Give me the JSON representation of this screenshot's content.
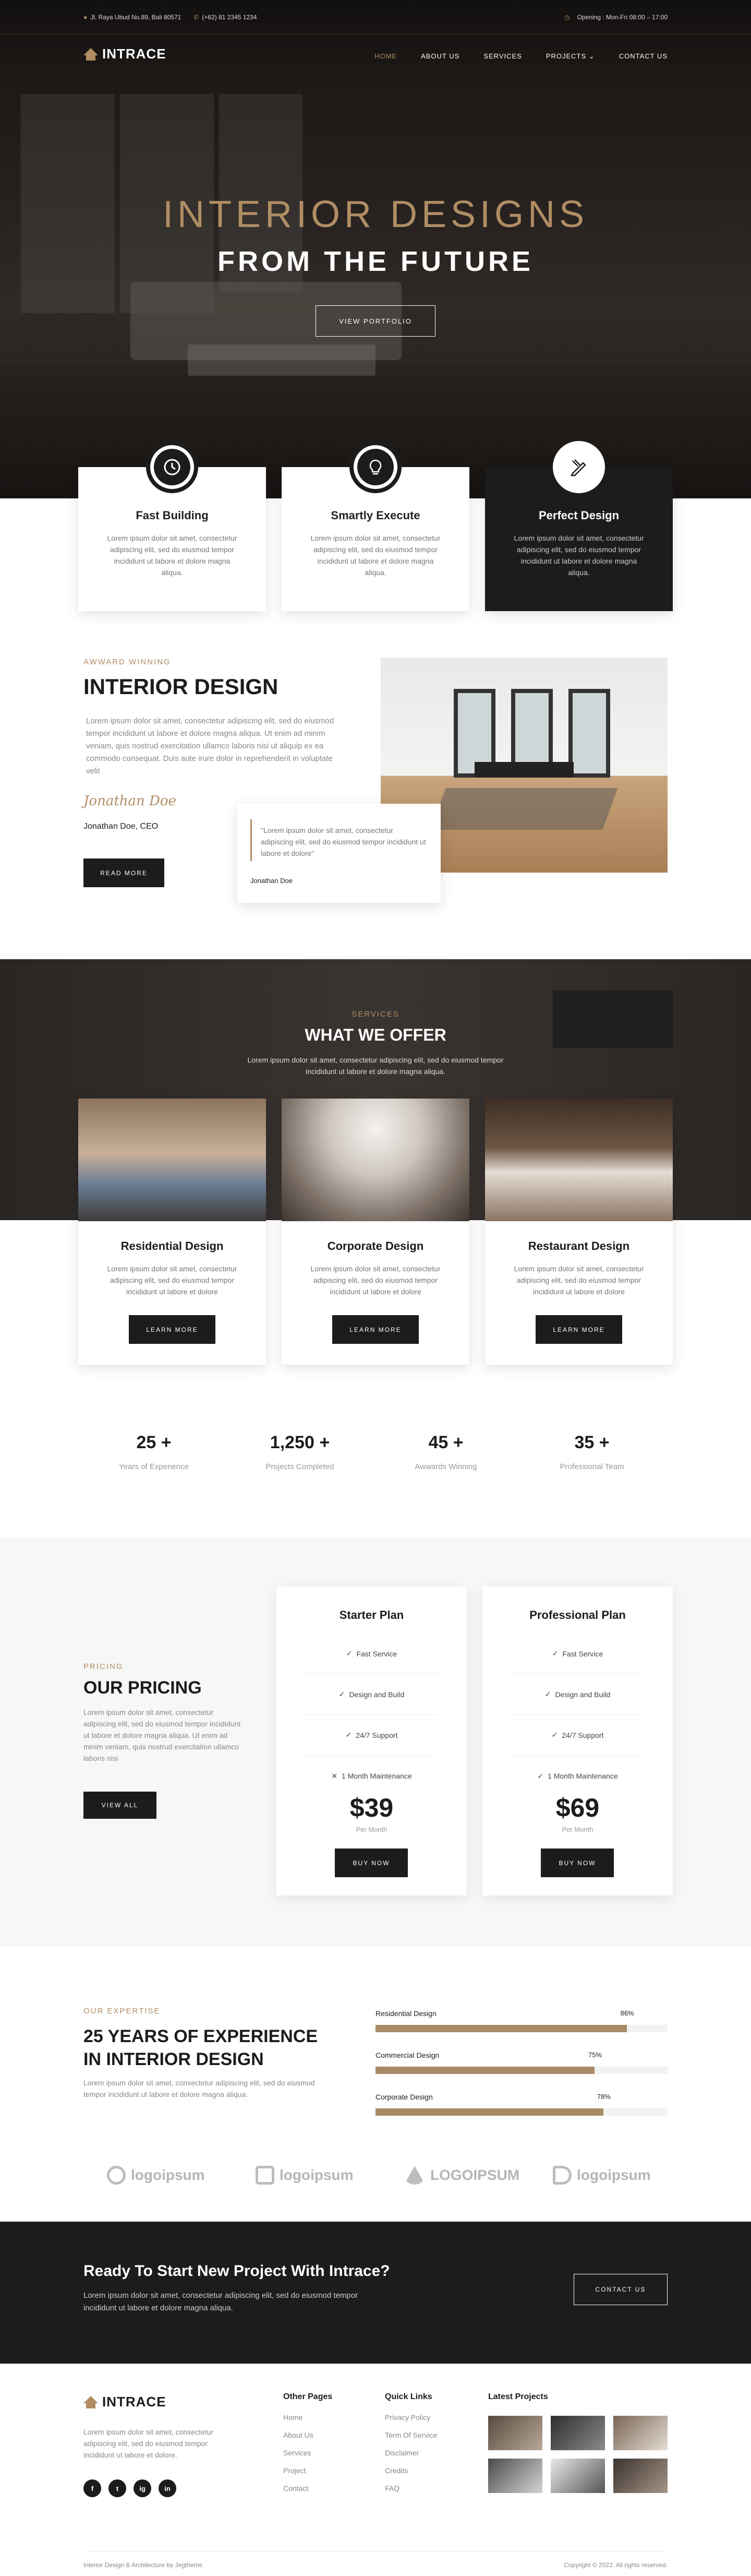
{
  "topbar": {
    "address": "Jl. Raya Ubud No.89, Bali 80571",
    "phone": "(+62) 81 2345 1234",
    "hours": "Opening : Mon-Fri 08:00 – 17:00"
  },
  "brand": {
    "name": "INTRACE"
  },
  "nav": {
    "items": [
      "HOME",
      "ABOUT US",
      "SERVICES",
      "PROJECTS",
      "CONTACT US"
    ],
    "active": "HOME"
  },
  "hero": {
    "title": "INTERIOR DESIGNS",
    "subtitle": "FROM THE FUTURE",
    "button": "VIEW PORTFOLIO"
  },
  "features": [
    {
      "icon": "clock-icon",
      "title": "Fast Building",
      "text": "Lorem ipsum dolor sit amet, consectetur adipiscing elit, sed do eiusmod tempor incididunt ut labore et dolore magna aliqua."
    },
    {
      "icon": "lightbulb-icon",
      "title": "Smartly Execute",
      "text": "Lorem ipsum dolor sit amet, consectetur adipiscing elit, sed do eiusmod tempor incididunt ut labore et dolore magna aliqua."
    },
    {
      "icon": "pencil-ruler-icon",
      "title": "Perfect Design",
      "text": "Lorem ipsum dolor sit amet, consectetur adipiscing elit, sed do eiusmod tempor incididunt ut labore et dolore magna aliqua."
    }
  ],
  "about": {
    "tag": "AWWARD WINNING",
    "title": "INTERIOR DESIGN",
    "text": "Lorem ipsum dolor sit amet, consectetur adipiscing elit, sed do eiusmod tempor incididunt ut labore et dolore magna aliqua. Ut enim ad minim veniam, quis nostrud exercitation ullamco laboris nisi ut aliquip ex ea commodo consequat. Duis aute irure dolor in reprehenderit in voluptate velit",
    "signature": "Jonathan Doe",
    "name": "Jonathan Doe, CEO",
    "button": "READ MORE",
    "quote": "\"Lorem ipsum dolor sit amet, consectetur adipiscing elit, sed do eiusmod tempor incididunt ut labore et dolore\"",
    "quote_author": "Jonathan Doe"
  },
  "services": {
    "tag": "SERVICES",
    "title": "WHAT WE OFFER",
    "text": "Lorem ipsum dolor sit amet, consectetur adipiscing elit, sed do eiusmod tempor incididunt ut labore et dolore magna aliqua.",
    "cards": [
      {
        "title": "Residential Design",
        "text": "Lorem ipsum dolor sit amet, consectetur adipiscing elit, sed do eiusmod tempor incididunt ut labore et dolore",
        "button": "LEARN MORE"
      },
      {
        "title": "Corporate Design",
        "text": "Lorem ipsum dolor sit amet, consectetur adipiscing elit, sed do eiusmod tempor incididunt ut labore et dolore",
        "button": "LEARN MORE"
      },
      {
        "title": "Restaurant Design",
        "text": "Lorem ipsum dolor sit amet, consectetur adipiscing elit, sed do eiusmod tempor incididunt ut labore et dolore",
        "button": "LEARN MORE"
      }
    ]
  },
  "stats": [
    {
      "value": "25 +",
      "label": "Years of Experience"
    },
    {
      "value": "1,250 +",
      "label": "Projects Completed"
    },
    {
      "value": "45 +",
      "label": "Awwards Winning"
    },
    {
      "value": "35 +",
      "label": "Professional Team"
    }
  ],
  "pricing": {
    "tag": "PRICING",
    "title": "OUR PRICING",
    "text": "Lorem ipsum dolor sit amet, consectetur adipiscing elit, sed do eiusmod tempor incididunt ut labore et dolore magna aliqua. Ut enim ad minim veniam, quis nostrud exercitation ullamco laboris nisi",
    "button": "VIEW ALL",
    "plans": [
      {
        "name": "Starter Plan",
        "features": [
          {
            "label": "Fast Service",
            "included": true
          },
          {
            "label": "Design and Build",
            "included": true
          },
          {
            "label": "24/7 Support",
            "included": true
          },
          {
            "label": "1 Month Maintenance",
            "included": false
          }
        ],
        "price": "$39",
        "period": "Per Month",
        "button": "BUY NOW"
      },
      {
        "name": "Professional Plan",
        "features": [
          {
            "label": "Fast Service",
            "included": true
          },
          {
            "label": "Design and Build",
            "included": true
          },
          {
            "label": "24/7 Support",
            "included": true
          },
          {
            "label": "1 Month Maintenance",
            "included": true
          }
        ],
        "price": "$69",
        "period": "Per Month",
        "button": "BUY NOW"
      }
    ]
  },
  "expertise": {
    "tag": "OUR EXPERTISE",
    "title": "25 YEARS OF EXPERIENCE IN INTERIOR DESIGN",
    "text": "Lorem ipsum dolor sit amet, consectetur adipiscing elit, sed do eiusmod tempor incididunt ut labore et dolore magna aliqua.",
    "skills": [
      {
        "label": "Residential Design",
        "percent": 86
      },
      {
        "label": "Commercial Design",
        "percent": 75
      },
      {
        "label": "Corporate Design",
        "percent": 78
      }
    ]
  },
  "logos": [
    "logoipsum",
    "logoipsum",
    "LOGOIPSUM",
    "logoipsum"
  ],
  "cta": {
    "title": "Ready To Start New Project With Intrace?",
    "text": "Lorem ipsum dolor sit amet, consectetur adipiscing elit, sed do eiusmod tempor incididunt ut labore et dolore magna aliqua.",
    "button": "CONTACT US"
  },
  "footer": {
    "text": "Lorem ipsum dolor sit amet, consectetur adipiscing elit, sed do eiusmod tempor incididunt ut labore et dolore.",
    "social": [
      "f",
      "t",
      "ig",
      "in"
    ],
    "other_pages": {
      "title": "Other Pages",
      "links": [
        "Home",
        "About Us",
        "Services",
        "Project",
        "Contact"
      ]
    },
    "quick_links": {
      "title": "Quick Links",
      "links": [
        "Privacy Policy",
        "Term Of Service",
        "Disclaimer",
        "Credits",
        "FAQ"
      ]
    },
    "latest_projects": {
      "title": "Latest Projects"
    },
    "credit": "Interior Design & Architecture by Jegtheme",
    "copyright": "Copyright © 2022. All rights reserved."
  },
  "colors": {
    "accent": "#b08d63",
    "dark": "#1c1c1c"
  }
}
